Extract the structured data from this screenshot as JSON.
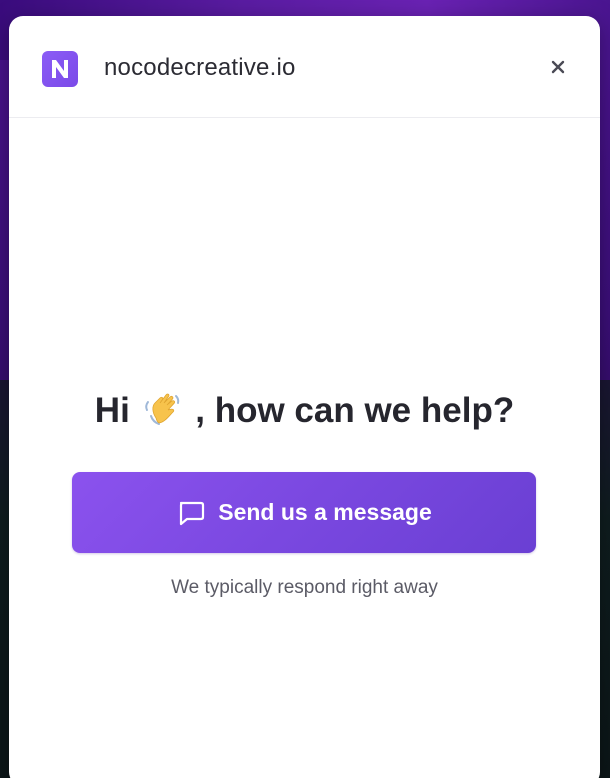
{
  "header": {
    "brand_name": "nocodecreative.io",
    "logo_icon": "n-logo-icon",
    "close_icon": "close-icon"
  },
  "main": {
    "greeting_before": "Hi",
    "greeting_emoji": "waving-hand-icon",
    "greeting_after": ", how can we help?",
    "cta_label": "Send us a message",
    "cta_icon": "chat-bubble-icon",
    "response_note": "We typically respond right away"
  },
  "colors": {
    "accent": "#7c4ae6",
    "logo": "#8b5cf6",
    "text_dark": "#26262e",
    "text_muted": "#5b5b66"
  }
}
